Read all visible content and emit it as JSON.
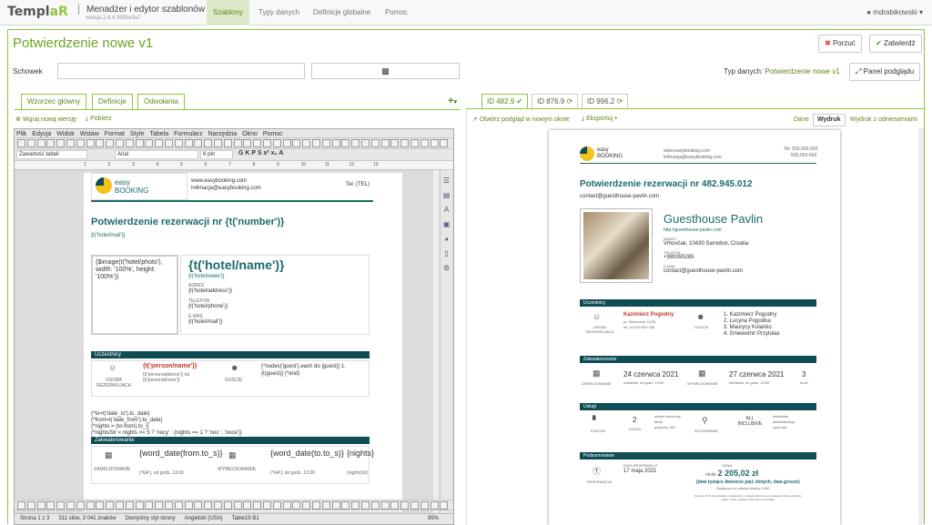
{
  "nav": {
    "logo_main": "Templ",
    "logo_accent": "aR",
    "app_title": "Menadżer i edytor szablonów",
    "version": "wersja 2.6.4.390be3a7",
    "tabs": [
      "Szablony",
      "Typy danych",
      "Definicje globalne",
      "Pomoc"
    ],
    "active_tab": 0,
    "user": "mdrabikowski"
  },
  "page": {
    "title": "Potwierdzenie nowe v1",
    "discard": "Porzuć",
    "accept": "Zatwierdź",
    "clipboard_label": "Schowek",
    "datatype_label": "Typ danych:",
    "datatype_value": "Potwierdzenie nowe v1",
    "preview_panel": "Panel podglądu"
  },
  "left_tabs": [
    "Wzorzec główny",
    "Definicje",
    "Odwołania"
  ],
  "left_actions": {
    "upload": "Wgraj nową wersję",
    "download": "Pobierz"
  },
  "lo": {
    "menu": [
      "Plik",
      "Edycja",
      "Widok",
      "Wstaw",
      "Format",
      "Style",
      "Tabela",
      "Formularz",
      "Narzędzia",
      "Okno",
      "Pomoc"
    ],
    "style_box": "Zawartość tabeli",
    "font_box": "Arial",
    "size_box": "6 pkt",
    "ruler": [
      "1",
      "2",
      "3",
      "4",
      "5",
      "6",
      "7",
      "8",
      "9",
      "10",
      "11",
      "12",
      "13"
    ],
    "status": [
      "Strona 1 z 3",
      "311 słów, 3 041 znaków",
      "Domyślny styl strony",
      "Angielski (USA)",
      "Table19 B1",
      "95%"
    ]
  },
  "tpl": {
    "logo_top": "easy",
    "logo_bottom": "BOOKING",
    "web": "www.easybooking.com",
    "mail": "in4macja@easybooking.com",
    "tel": "Tel: (TEL)",
    "heading": "Potwierdzenie rezerwacji nr {t('number')}",
    "hotel_mail": "{t('hotel/mail')}",
    "photo_expr": "{$image(t('hotel/photo'), width: '100%', height: '100%')}",
    "hotel_name": "{t('hotel/name')}",
    "hotel_www": "{t('hotel/www')}",
    "addr_lbl": "ADRES",
    "addr": "{t('hotel/address')}",
    "tel_lbl": "TELEFON",
    "phone": "{t('hotel/phone')}",
    "mail_lbl": "E-MAIL",
    "hmail": "{t('hotel/mail')}",
    "sec1": "Uczestnicy",
    "person_lbl": "OSOBA REZERWUJĄCA",
    "person": "{t('person/name')}",
    "person_sub": "{t('person/address')} tel. {t('person/phone')}",
    "guests_lbl": "GOŚCIE",
    "guests_expr": "{*nodes('guest').each do |guest|} 1. {t(guest)} {*end}",
    "code1": "{*to=t('date_to').to_date}",
    "code2": "{*from=t('date_from').to_date}",
    "code3": "{*nights = (to-from).to_i}",
    "code4": "{*nightsStr = nights >= 5 ? 'nocy' : (nights == 1 ? 'noc' : 'noce')}",
    "sec2": "Zakwaterowanie",
    "checkin_lbl": "ZAMELDOWANIE",
    "checkin": "{word_date(from.to_s)}",
    "checkin_sub": "{'%A'}, od godz. 13:00",
    "checkout_lbl": "WYMELDOWANIE",
    "checkout": "{word_date(to.to_s)}",
    "checkout_sub": "{'%A'}, do godz. 12:00",
    "nights": "{nights}",
    "nights_sub": "{nightsStr}"
  },
  "right_tabs": [
    {
      "label": "ID 482.9",
      "icon": "check"
    },
    {
      "label": "ID 876.9",
      "icon": "refresh"
    },
    {
      "label": "ID 996.2",
      "icon": "refresh"
    }
  ],
  "right_actions": {
    "open": "Otwórz podgląd w nowym oknie",
    "export": "Eksportuj"
  },
  "view_tabs": [
    "Dane",
    "Wydruk",
    "Wydruk z odniesieniami"
  ],
  "active_view": 1,
  "pv": {
    "logo_top": "easy",
    "logo_bottom": "BOOKING",
    "web": "www.easybooking.com",
    "mail": "in4macja@easybooking.com",
    "tel1": "Tel: 555-555-555",
    "tel2": "555-555-666",
    "heading": "Potwierdzenie rezerwacji nr 482.945.012",
    "contact": "contact@guesthouse-pavlin.com",
    "hotel": "Guesthouse Pavlin",
    "hotel_web": "http://guesthouse-pavlin.com",
    "addr_lbl": "ADRES",
    "addr": "Vrhovčak, 10430 Samobor, Croatia",
    "tel_lbl": "TELEFON",
    "phone": "+989395285",
    "mail_lbl": "E-MAIL",
    "hmail": "contact@guesthouse-pavlin.com",
    "sec1": "Uczestnicy",
    "person_lbl": "OSOBA REZERWUJĄCA",
    "person": "Kazimierz Pogodny",
    "person_a1": "ul. Słoneczna 10/25",
    "person_a2": "tel. 44 929 929 106",
    "guests_lbl": "GOŚCIE",
    "guests": [
      "Kazimierz Pogodny",
      "Lucyna Pogodna",
      "Maurycy Kolanko",
      "Gniewomir Przytulas"
    ],
    "sec2": "Zakwaterowanie",
    "checkin_lbl": "ZAMELDOWANIE",
    "checkin": "24 czerwca 2021",
    "checkin_sub": "czwartek, od godz. 13:00",
    "checkout_lbl": "WYMELDOWANIE",
    "checkout": "27 czerwca 2021",
    "checkout_sub": "niedziela, do godz. 12:00",
    "nights": "3",
    "nights_sub": "noce",
    "sec3": "Usługi",
    "rooms_lbl": "POKOJE",
    "beds": "2",
    "beds_lbl": "ŁÓŻKA",
    "rooms_desc1": "aneks kuchenny",
    "rooms_desc2": "taras",
    "rooms_desc3": "prysznic, WC",
    "food_lbl": "WYŻYWIENIE",
    "food": "ALL INCLUSIVE",
    "food_desc1": "śniadanie",
    "food_desc2": "obiadokolacja",
    "food_desc3": "open bar",
    "sec4": "Podsumowanie",
    "res_lbl": "REZERWACJA",
    "date_lbl": "DATA REZERWACJI",
    "date": "17 maja 2021",
    "price_lbl": "CENA",
    "price_prefix": "około",
    "price": "2 205,02 zł",
    "price_words": "(dwa tysiące dwieście pięć złotych, dwa grosze)",
    "paid": "Zapłacono w całości kwotą 4 660",
    "foot1": "Kwota w PLN ma charakter orientacyjny i została obliczona po podstawie kursu wymiany",
    "foot2": "walut z dnia, w którym dokonano rezerwacji"
  }
}
